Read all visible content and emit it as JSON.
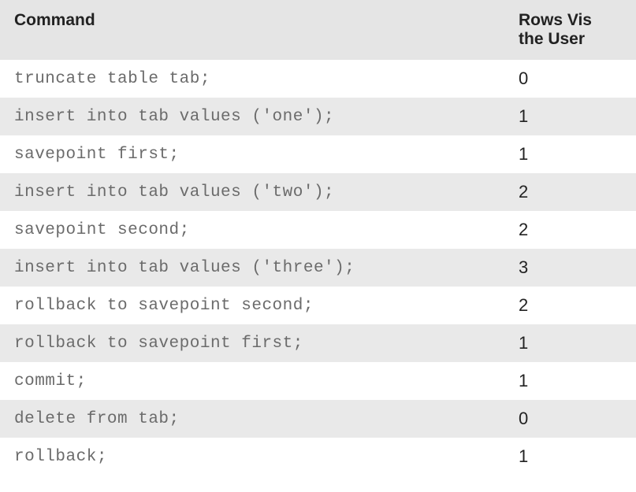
{
  "table": {
    "headers": {
      "command": "Command",
      "rows_visible_line1": "Rows Vis",
      "rows_visible_line2": "the User"
    },
    "rows": [
      {
        "command": "truncate table tab;",
        "rows_visible": "0"
      },
      {
        "command": "insert into tab values ('one');",
        "rows_visible": "1"
      },
      {
        "command": "savepoint first;",
        "rows_visible": "1"
      },
      {
        "command": "insert into tab values ('two');",
        "rows_visible": "2"
      },
      {
        "command": "savepoint second;",
        "rows_visible": "2"
      },
      {
        "command": "insert into tab values ('three');",
        "rows_visible": "3"
      },
      {
        "command": "rollback to savepoint second;",
        "rows_visible": "2"
      },
      {
        "command": "rollback to savepoint first;",
        "rows_visible": "1"
      },
      {
        "command": "commit;",
        "rows_visible": "1"
      },
      {
        "command": "delete from tab;",
        "rows_visible": "0"
      },
      {
        "command": "rollback;",
        "rows_visible": "1"
      }
    ]
  }
}
